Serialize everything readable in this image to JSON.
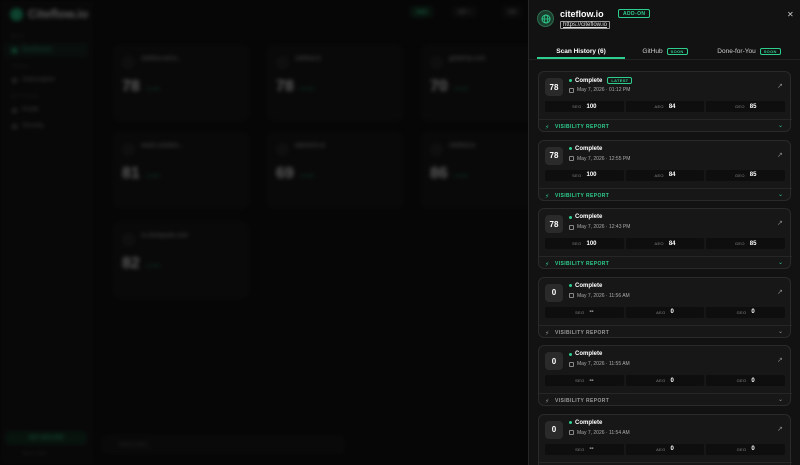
{
  "background": {
    "logo_text": "Citeflow.io",
    "sidebar_sections": [
      "MAIN",
      "TOOLS",
      "SETTINGS"
    ],
    "sidebar_items": [
      "Dashboard",
      "Subscription",
      "Profile",
      "Security"
    ],
    "cta_label": "GET ADD-ONS",
    "footer": "Need help?",
    "cards": [
      {
        "title": "citeflow.servo...",
        "score": "78",
        "tag": "SCORE"
      },
      {
        "title": "citeflow.io",
        "score": "78",
        "tag": "SCORE"
      },
      {
        "title": "getdemp.com",
        "score": "70",
        "tag": "SCORE"
      },
      {
        "title": "seam-solution...",
        "score": "81",
        "tag": "SCORE"
      },
      {
        "title": "tatertech.ai",
        "score": "69",
        "tag": "SCORE"
      },
      {
        "title": "citeflow.io",
        "score": "86",
        "tag": "SCORE"
      },
      {
        "title": "m.clonepods.com",
        "score": "82",
        "tag": "SCORE"
      }
    ],
    "search_placeholder": "Search sites..."
  },
  "panel": {
    "site_name": "citeflow.io",
    "addon_badge": "ADD-ON",
    "site_url": "https://citeflow.io",
    "close_glyph": "✕",
    "tabs": [
      {
        "label": "Scan History (6)",
        "badge": ""
      },
      {
        "label": "GitHub",
        "badge": "SOON"
      },
      {
        "label": "Done-for-You",
        "badge": "SOON"
      }
    ],
    "visibility_label": "VISIBILITY REPORT",
    "metric_labels": {
      "seo": "SEO",
      "aeo": "AEO",
      "geo": "GEO"
    },
    "scans": [
      {
        "score": "78",
        "status": "Complete",
        "latest": "LATEST",
        "date": "May 7, 2026 · 01:12 PM",
        "seo": "100",
        "aeo": "84",
        "geo": "85",
        "highlight": true
      },
      {
        "score": "78",
        "status": "Complete",
        "latest": "",
        "date": "May 7, 2026 · 12:55 PM",
        "seo": "100",
        "aeo": "84",
        "geo": "85",
        "highlight": true
      },
      {
        "score": "78",
        "status": "Complete",
        "latest": "",
        "date": "May 7, 2026 · 12:43 PM",
        "seo": "100",
        "aeo": "84",
        "geo": "85",
        "highlight": true
      },
      {
        "score": "0",
        "status": "Complete",
        "latest": "",
        "date": "May 7, 2026 · 11:56 AM",
        "seo": "--",
        "aeo": "0",
        "geo": "0",
        "highlight": false
      },
      {
        "score": "0",
        "status": "Complete",
        "latest": "",
        "date": "May 7, 2026 · 11:55 AM",
        "seo": "--",
        "aeo": "0",
        "geo": "0",
        "highlight": false
      },
      {
        "score": "0",
        "status": "Complete",
        "latest": "",
        "date": "May 7, 2026 · 11:54 AM",
        "seo": "--",
        "aeo": "0",
        "geo": "0",
        "highlight": false
      }
    ],
    "colors": {
      "accent": "#2ecf8e",
      "panel_bg": "#121212",
      "card_bg": "#171717"
    }
  }
}
